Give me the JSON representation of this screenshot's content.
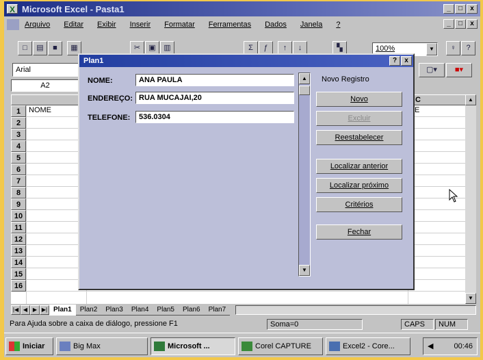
{
  "window": {
    "title": "Microsoft Excel - Pasta1",
    "min": "_",
    "max": "□",
    "close": "x"
  },
  "menu": [
    "Arquivo",
    "Editar",
    "Exibir",
    "Inserir",
    "Formatar",
    "Ferramentas",
    "Dados",
    "Janela",
    "?"
  ],
  "toolbar": {
    "zoom": "100%",
    "font": "Arial"
  },
  "formula": {
    "cell_ref": "A2"
  },
  "grid": {
    "rows": [
      "1",
      "2",
      "3",
      "4",
      "5",
      "6",
      "7",
      "8",
      "9",
      "10",
      "11",
      "12",
      "13",
      "14",
      "15",
      "16"
    ],
    "a1": "NOME",
    "c1_fragment_top": "C",
    "c1_fragment": "E"
  },
  "sheets": [
    "Plan1",
    "Plan2",
    "Plan3",
    "Plan4",
    "Plan5",
    "Plan6",
    "Plan7"
  ],
  "status": {
    "help": "Para Ajuda sobre a caixa de diálogo, pressione F1",
    "sum": "Soma=0",
    "caps": "CAPS",
    "num": "NUM"
  },
  "taskbar": {
    "start": "Iniciar",
    "items": [
      "Big Max",
      "Microsoft ...",
      "Corel CAPTURE",
      "Excel2 - Core..."
    ],
    "time": "00:46"
  },
  "dialog": {
    "title": "Plan1",
    "help": "?",
    "close": "x",
    "fields": [
      {
        "label": "NOME:",
        "value": "ANA PAULA"
      },
      {
        "label": "ENDEREÇO:",
        "value": "RUA MUCAJAI,20"
      },
      {
        "label": "TELEFONE:",
        "value": "536.0304"
      }
    ],
    "record_status": "Novo Registro",
    "buttons": {
      "new": "Novo",
      "delete": "Excluir",
      "restore": "Reestabelecer",
      "find_prev": "Localizar anterior",
      "find_next": "Localizar próximo",
      "criteria": "Critérios",
      "close": "Fechar"
    }
  },
  "colors": {
    "title_bar": "#1e2f86",
    "dialog_bg": "#bcbfd9",
    "frame": "#f2c84a"
  }
}
